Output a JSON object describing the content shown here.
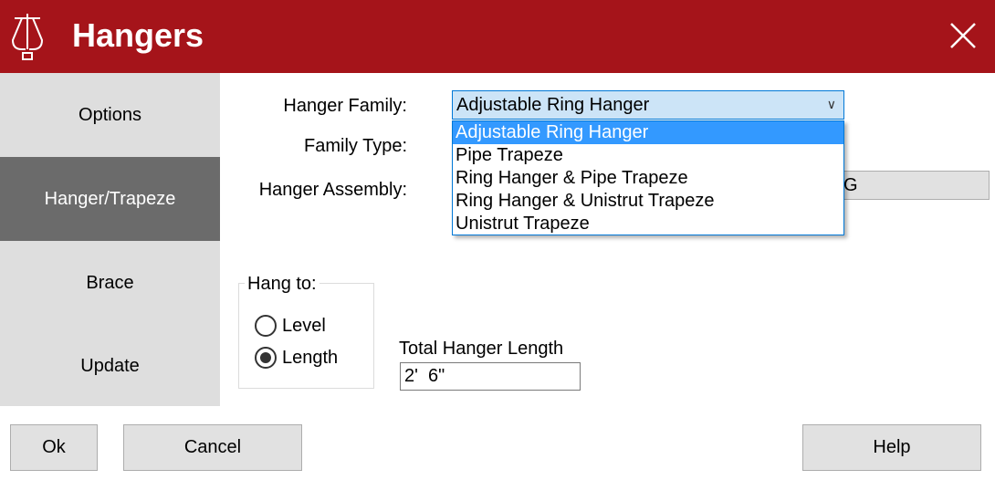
{
  "window": {
    "title": "Hangers",
    "accent": "#A5141A"
  },
  "sidebar": {
    "items": [
      {
        "label": "Options"
      },
      {
        "label": "Hanger/Trapeze",
        "active": true
      },
      {
        "label": "Brace"
      },
      {
        "label": "Update"
      }
    ]
  },
  "form": {
    "hanger_family_label": "Hanger Family:",
    "hanger_family_value": "Adjustable Ring Hanger",
    "family_type_label": "Family Type:",
    "hanger_assembly_label": "Hanger Assembly:",
    "hanger_assembly_value_visible": "G",
    "options": [
      "Adjustable Ring Hanger",
      "Pipe Trapeze",
      "Ring Hanger & Pipe Trapeze",
      "Ring Hanger & Unistrut Trapeze",
      "Unistrut Trapeze"
    ],
    "hang_to": {
      "title": "Hang to:",
      "level": "Level",
      "length": "Length",
      "selected": "Length"
    },
    "total_length_label": "Total Hanger Length",
    "total_length_value": "2'  6\""
  },
  "buttons": {
    "ok": "Ok",
    "cancel": "Cancel",
    "help": "Help"
  }
}
